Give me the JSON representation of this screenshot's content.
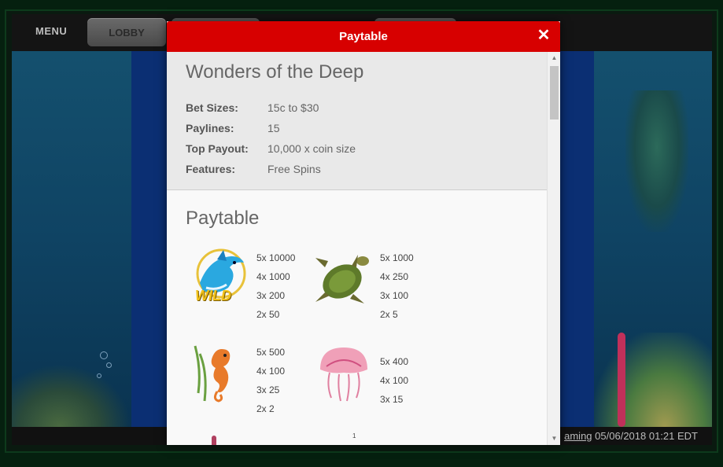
{
  "topbar": {
    "menu_label": "MENU",
    "lobby_label": "LOBBY"
  },
  "modal": {
    "title": "Paytable",
    "close_glyph": "✕"
  },
  "info": {
    "game_name": "Wonders of the Deep",
    "rows": [
      {
        "label": "Bet Sizes:",
        "value": "15c to $30"
      },
      {
        "label": "Paylines:",
        "value": "15"
      },
      {
        "label": "Top Payout:",
        "value": "10,000 x coin size"
      },
      {
        "label": "Features:",
        "value": "Free Spins"
      }
    ]
  },
  "paytable": {
    "title": "Paytable",
    "symbols": [
      {
        "icon": "dolphin-wild-icon",
        "wild_text": "WILD",
        "payouts": [
          "5x 10000",
          "4x 1000",
          "3x 200",
          "2x 50"
        ]
      },
      {
        "icon": "sea-turtle-icon",
        "payouts": [
          "5x 1000",
          "4x 250",
          "3x 100",
          "2x 5"
        ]
      },
      {
        "icon": "seahorse-icon",
        "payouts": [
          "5x 500",
          "4x 100",
          "3x 25",
          "2x 2"
        ]
      },
      {
        "icon": "jellyfish-icon",
        "payouts": [
          "5x 400",
          "4x 100",
          "3x 15"
        ]
      }
    ],
    "partial_marker": "1"
  },
  "status": {
    "link_text": "aming",
    "timestamp": "05/06/2018 01:21 EDT"
  },
  "colors": {
    "header_red": "#d70000",
    "page_green": "#05200f"
  }
}
